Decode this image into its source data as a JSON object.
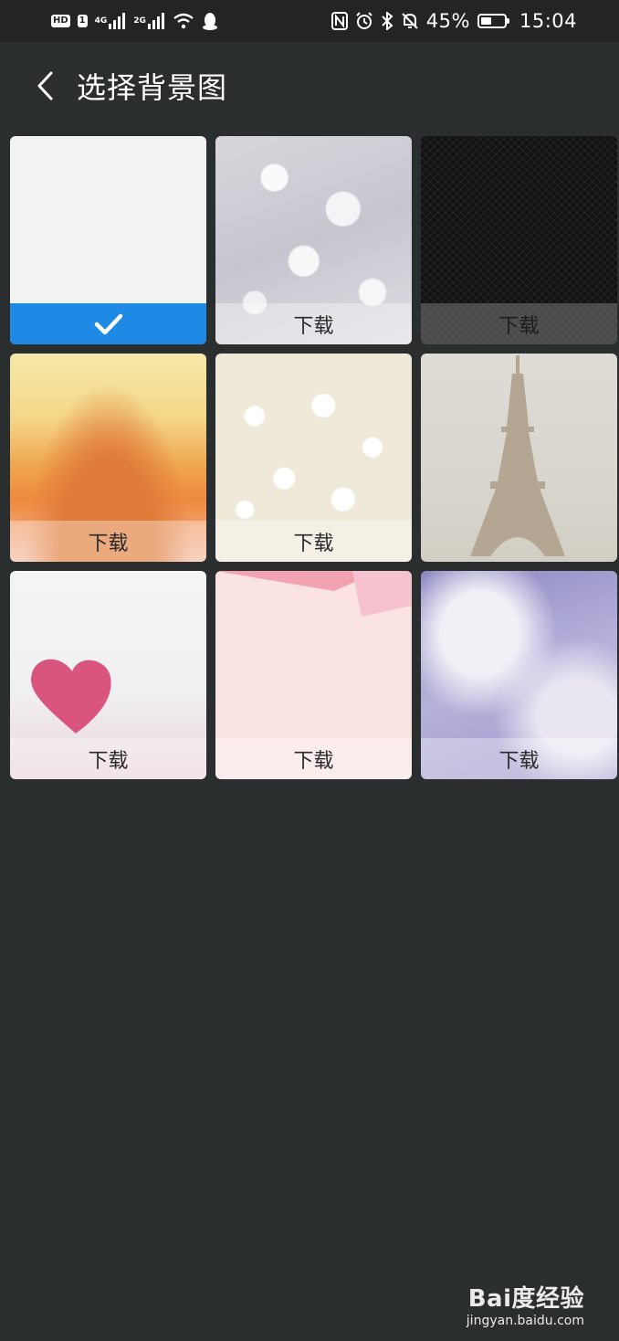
{
  "status_bar": {
    "hd_label": "HD",
    "sim_label": "1",
    "net1_label": "4G",
    "net2_label": "2G",
    "battery_percent": "45%",
    "battery_level": 0.45,
    "time": "15:04",
    "icons": [
      "signal-icon",
      "wifi-icon",
      "qq-icon",
      "nfc-icon",
      "alarm-icon",
      "bluetooth-icon",
      "mute-icon",
      "battery-icon"
    ]
  },
  "header": {
    "title": "选择背景图",
    "back_icon": "chevron-left-icon"
  },
  "tiles": [
    {
      "name": "plain-white",
      "status": "selected",
      "label": ""
    },
    {
      "name": "bokeh",
      "status": "download",
      "label": "下载"
    },
    {
      "name": "dark-texture",
      "status": "download",
      "label": "下载"
    },
    {
      "name": "golden-glitter",
      "status": "download",
      "label": "下载"
    },
    {
      "name": "white-flowers",
      "status": "download",
      "label": "下载"
    },
    {
      "name": "eiffel-tower",
      "status": "none",
      "label": ""
    },
    {
      "name": "pink-heart",
      "status": "download",
      "label": "下载"
    },
    {
      "name": "pink-paper",
      "status": "download",
      "label": "下载"
    },
    {
      "name": "purple-water-drops",
      "status": "download",
      "label": "下载"
    }
  ],
  "colors": {
    "background": "#2b2e2f",
    "status_bar": "#222425",
    "selected_accent": "#1e8ae6"
  },
  "watermark": {
    "logo": "Bai度经验",
    "url": "jingyan.baidu.com"
  }
}
